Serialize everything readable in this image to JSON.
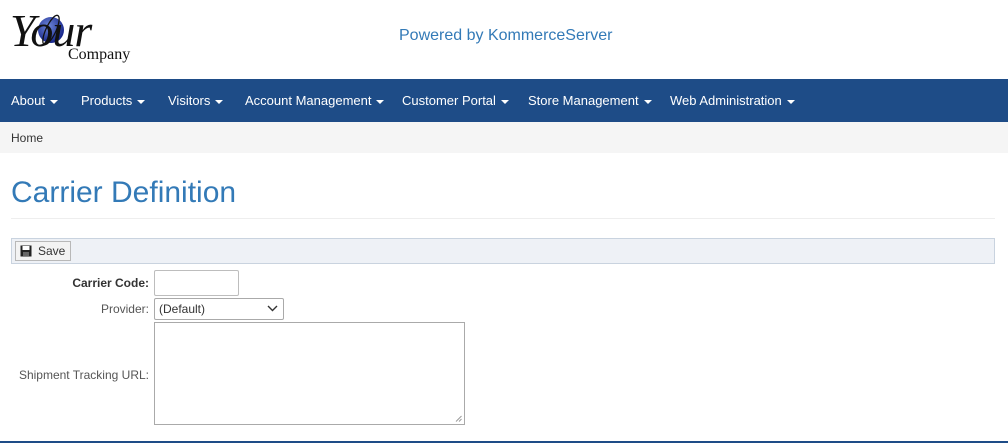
{
  "header": {
    "logo_your": "Your",
    "logo_company": "Company",
    "powered_by": "Powered by KommerceServer"
  },
  "nav": {
    "items": [
      {
        "label": "About"
      },
      {
        "label": "Products"
      },
      {
        "label": "Visitors"
      },
      {
        "label": "Account Management"
      },
      {
        "label": "Customer Portal"
      },
      {
        "label": "Store Management"
      },
      {
        "label": "Web Administration"
      }
    ]
  },
  "breadcrumb": {
    "home": "Home"
  },
  "page": {
    "title": "Carrier Definition"
  },
  "toolbar": {
    "save_label": "Save"
  },
  "form": {
    "carrier_code_label": "Carrier Code:",
    "carrier_code_value": "",
    "provider_label": "Provider:",
    "provider_selected": "(Default)",
    "tracking_url_label": "Shipment Tracking URL:",
    "tracking_url_value": ""
  },
  "colors": {
    "navbar": "#1e4c87",
    "accent": "#337ab7",
    "breadcrumb_bg": "#f5f5f5"
  }
}
